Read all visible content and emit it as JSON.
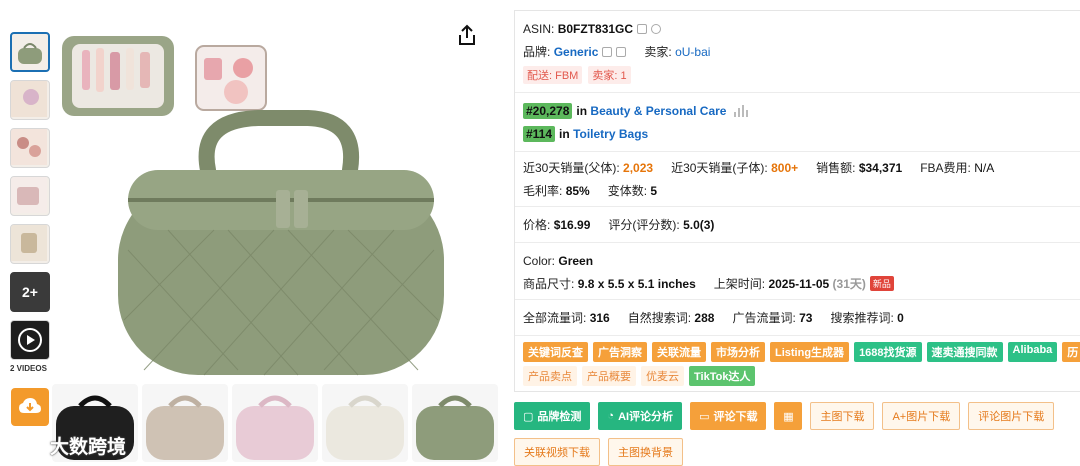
{
  "gallery": {
    "more_label": "2+",
    "videos_label": "2 VIDEOS"
  },
  "watermark": {
    "text": "大数跨境"
  },
  "product": {
    "asin_label": "ASIN:",
    "asin": "B0FZT831GC",
    "brand_label": "品牌:",
    "brand": "Generic",
    "seller_label": "卖家:",
    "seller": "oU-bai",
    "ship_tag": "配送: FBM",
    "seller_count_tag": "卖家: 1",
    "rank1": "#20,278",
    "rank1_in": "in",
    "rank1_cat": "Beauty & Personal Care",
    "rank2": "#114",
    "rank2_in": "in",
    "rank2_cat": "Toiletry Bags"
  },
  "stats": {
    "sales_parent_label": "近30天销量(父体):",
    "sales_parent": "2,023",
    "sales_child_label": "近30天销量(子体):",
    "sales_child": "800+",
    "revenue_label": "销售额:",
    "revenue": "$34,371",
    "fba_label": "FBA费用:",
    "fba": "N/A",
    "margin_label": "毛利率:",
    "margin": "85%",
    "variants_label": "变体数:",
    "variants": "5",
    "price_label": "价格:",
    "price": "$16.99",
    "rating_label": "评分(评分数):",
    "rating": "5.0(3)",
    "color_label": "Color:",
    "color": "Green",
    "size_label": "商品尺寸:",
    "size": "9.8 x 5.5 x 5.1 inches",
    "listed_label": "上架时间:",
    "listed": "2025-11-05",
    "listed_days": "(31天)",
    "new_badge": "新品",
    "kw_all_label": "全部流量词:",
    "kw_all": "316",
    "kw_organic_label": "自然搜索词:",
    "kw_organic": "288",
    "kw_ad_label": "广告流量词:",
    "kw_ad": "73",
    "kw_rec_label": "搜索推荐词:",
    "kw_rec": "0"
  },
  "tools_row1": [
    {
      "label": "关键词反查",
      "style": "t-orange"
    },
    {
      "label": "广告洞察",
      "style": "t-orange"
    },
    {
      "label": "关联流量",
      "style": "t-orange"
    },
    {
      "label": "市场分析",
      "style": "t-orange"
    },
    {
      "label": "Listing生成器",
      "style": "t-orange"
    },
    {
      "label": "1688找货源",
      "style": "t-green"
    },
    {
      "label": "速卖通搜同款",
      "style": "t-green"
    },
    {
      "label": "Alibaba",
      "style": "t-green"
    },
    {
      "label": "历",
      "style": "t-orange"
    }
  ],
  "tools_row2": [
    {
      "label": "产品卖点",
      "style": "t-light"
    },
    {
      "label": "产品概要",
      "style": "t-light"
    },
    {
      "label": "优麦云",
      "style": "t-light"
    },
    {
      "label": "TikTok达人",
      "style": "t-green2"
    }
  ],
  "actions": {
    "brand_check": "品牌检测",
    "ai_review": "AI评论分析",
    "review_download": "评论下载",
    "main_image_download": "主图下载",
    "aplus_download": "A+图片下载",
    "review_image_download": "评论图片下载",
    "video_download": "关联视频下载",
    "bg_replace": "主图换背景"
  },
  "colors": {
    "rank_green": "#5cb85c",
    "link_blue": "#1769c2",
    "accent_orange": "#f5a03a",
    "action_green": "#26b680",
    "bag_green": "#8e9c7b"
  }
}
